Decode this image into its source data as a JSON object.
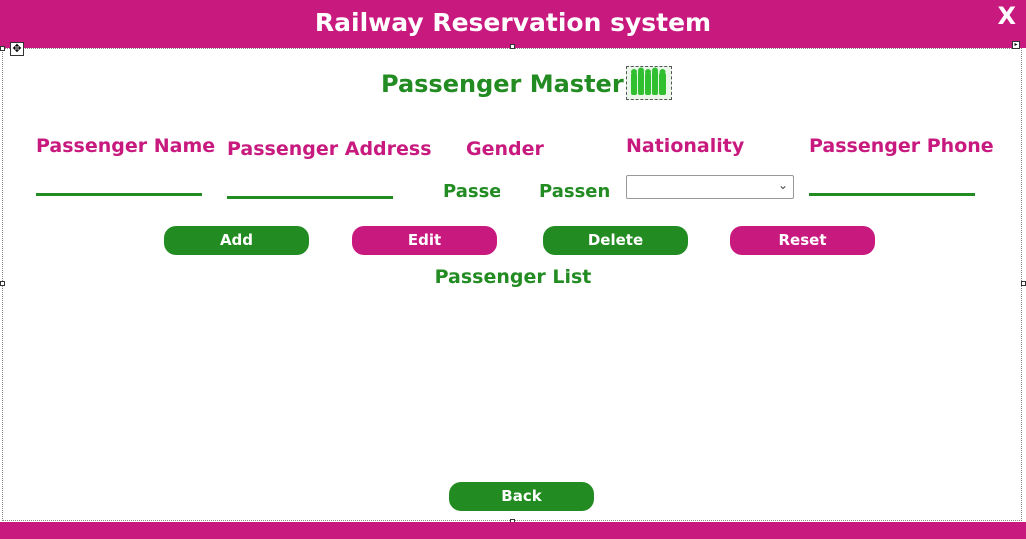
{
  "window": {
    "title": "Railway Reservation system",
    "close_label": "X"
  },
  "form": {
    "heading": "Passenger Master",
    "labels": {
      "name": "Passenger Name",
      "address": "Passenger Address",
      "gender": "Gender",
      "nationality": "Nationality",
      "phone": "Passenger Phone"
    },
    "inputs": {
      "name_value": "",
      "address_value": "",
      "phone_value": "",
      "nationality_value": ""
    },
    "gender_options": [
      "Passe",
      "Passen"
    ],
    "buttons": {
      "add": "Add",
      "edit": "Edit",
      "delete": "Delete",
      "reset": "Reset"
    },
    "list_title": "Passenger List",
    "back": "Back"
  },
  "colors": {
    "accent_pink": "#c8197f",
    "accent_green": "#228b22"
  },
  "icons": [
    "close-icon",
    "passengers-logo-icon",
    "move-handle-icon",
    "dropdown-chevron-icon"
  ]
}
